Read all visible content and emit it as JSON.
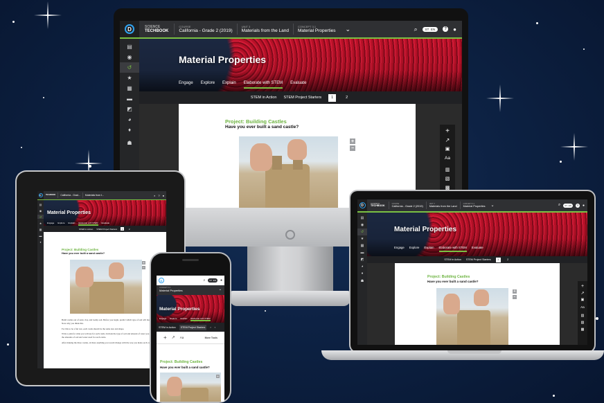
{
  "app": {
    "brand_line1": "SCIENCE",
    "brand_line2": "TECHBOOK",
    "logo_glyph": "D",
    "course_label": "COURSE",
    "course_value": "California - Grade 2 (2019)",
    "unit_label": "UNIT 3",
    "unit_value": "Materials from the Land",
    "concept_label": "CONCEPT 3.1",
    "concept_value": "Material Properties",
    "toggle_label": "ST  EN",
    "page_title": "Material Properties",
    "tabs": [
      "Engage",
      "Explore",
      "Explain",
      "Elaborate with STEM",
      "Evaluate"
    ],
    "subtabs": [
      "STEM in Action",
      "STEM Project Starters"
    ],
    "pages": [
      "1",
      "2"
    ],
    "project_title": "Project: Building Castles",
    "project_question": "Have you ever built a sand castle?",
    "more_tools": "More Tools"
  },
  "tablet": {
    "course_value": "California - Grad...",
    "unit_value": "Materials from t...",
    "paragraphs": [
      "Build castles out of sand, clay, and loamy soil. Before you begin, predict which type of soil will make the best castle. Note why you think this.",
      "For this to be a fair test, each castle should be the same size and shape.",
      "Write a plan for what you will use for each castle. Include the type of soil and amount of water you will use. Measure the amounts of soil and water used for each castle.",
      "After making the three castles, sit there anything you would change with the way you made each castle?"
    ]
  },
  "colors": {
    "accent_green": "#7ac143",
    "header_dark": "#2f3033",
    "hero_red": "#c4122a",
    "logo_blue": "#2ea3f2"
  }
}
